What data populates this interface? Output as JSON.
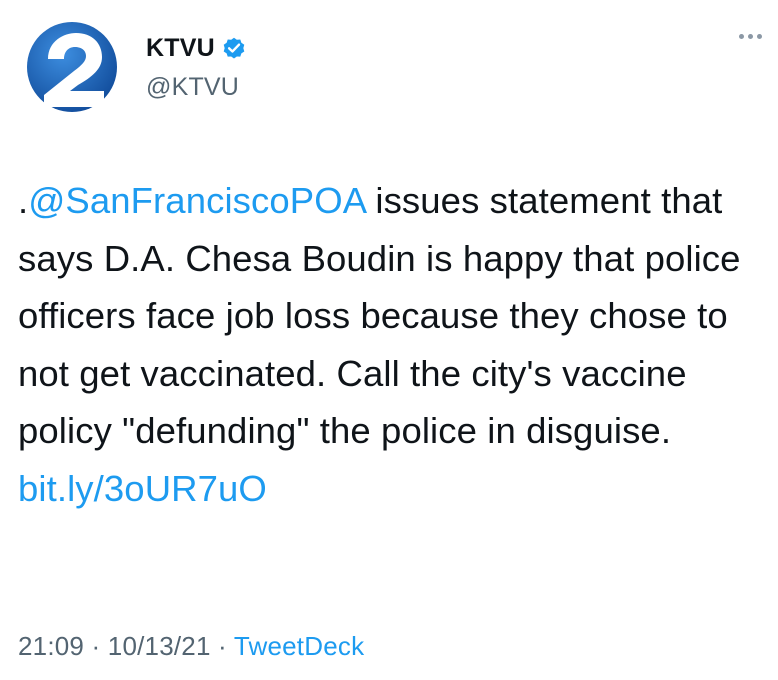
{
  "author": {
    "display_name": "KTVU",
    "handle": "@KTVU",
    "verified_icon": "verified-badge-icon",
    "avatar_icon": "ktvu-2-logo-icon",
    "colors": {
      "avatar_blue": "#1e5fb4",
      "verified": "#1d9bf0"
    }
  },
  "more_menu_icon": "more-dots-icon",
  "tweet": {
    "prefix": ".",
    "mention": "@SanFranciscoPOA",
    "body": " issues statement that says D.A. Chesa Boudin is happy that police officers face job loss because they chose to not get vaccinated. Call the city's vaccine policy \"defunding\" the police in disguise. ",
    "link": "bit.ly/3oUR7uO"
  },
  "meta": {
    "time": "21:09",
    "separator": " · ",
    "date": "10/13/21",
    "source": "TweetDeck"
  },
  "colors": {
    "link": "#1d9bf0",
    "secondary_text": "#536471",
    "text": "#0f1419"
  }
}
